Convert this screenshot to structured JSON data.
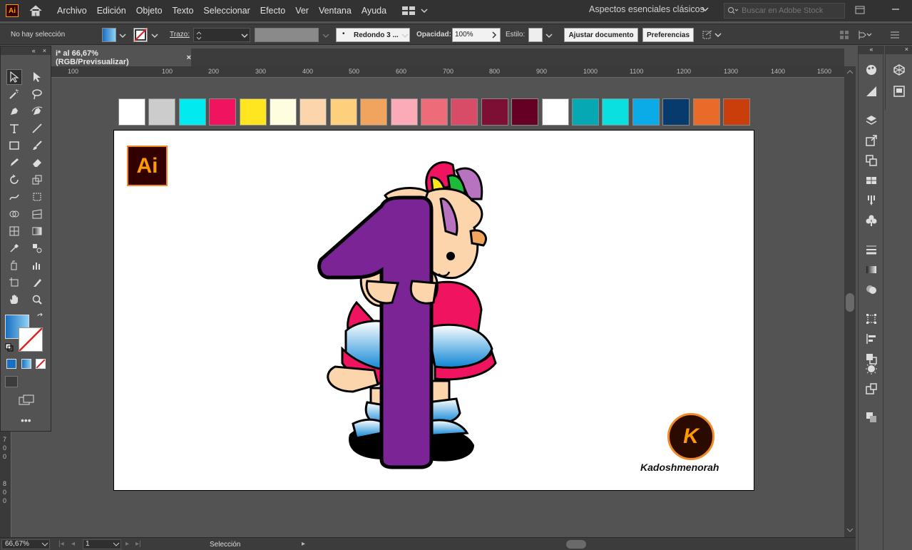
{
  "app": {
    "logo_text": "Ai"
  },
  "menu": {
    "items": [
      "Archivo",
      "Edición",
      "Objeto",
      "Texto",
      "Seleccionar",
      "Efecto",
      "Ver",
      "Ventana",
      "Ayuda"
    ]
  },
  "workspace": {
    "label": "Aspectos esenciales clásicos"
  },
  "stock_search": {
    "placeholder": "Buscar en Adobe Stock"
  },
  "control": {
    "selection": "No hay selección",
    "stroke_label": "Trazo:",
    "brush": "Redondo 3 ...",
    "opacity_label": "Opacidad:",
    "opacity_value": "100%",
    "style_label": "Estilo:",
    "fit_button": "Ajustar documento",
    "prefs_button": "Preferencias"
  },
  "document": {
    "tab_title": "i* al 66,67% (RGB/Previsualizar)",
    "close": "×"
  },
  "ruler": {
    "h_ticks": [
      "100",
      "100",
      "200",
      "300",
      "400",
      "500",
      "600",
      "700",
      "800",
      "900",
      "1000",
      "1100",
      "1200",
      "1300",
      "1400",
      "1500"
    ],
    "v_ticks": [
      "7",
      "0",
      "0",
      "8",
      "0",
      "0"
    ]
  },
  "colors": {
    "accent": "#3daee9",
    "ui_dark": "#323232",
    "panel": "#535353"
  },
  "swatches": [
    "#ffffff",
    "#cccccc",
    "#00eaf0",
    "#f01460",
    "#ffe620",
    "#fffde0",
    "#fdd5ac",
    "#fecf7c",
    "#f0a45e",
    "#fbaab8",
    "#ee6b7a",
    "#d84c68",
    "#7d0e34",
    "#650024",
    "#ffffff",
    "#06a8b3",
    "#0be0e1",
    "#0aabe7",
    "#073b6e",
    "#ea6a2a",
    "#c93e0b"
  ],
  "artwork": {
    "logo_text": "Ai",
    "watermark_letter": "K",
    "watermark_text": "Kadoshmenorah"
  },
  "status": {
    "zoom": "66,67%",
    "artboard_num": "1",
    "tool": "Selección"
  }
}
